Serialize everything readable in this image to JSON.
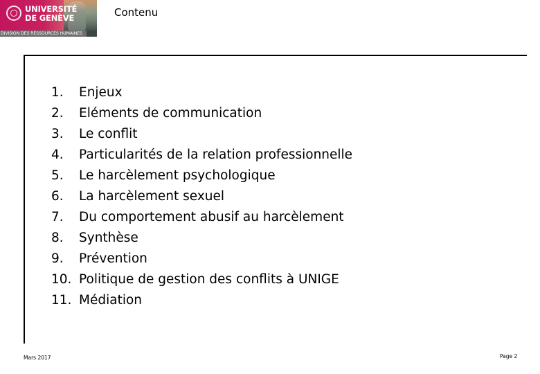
{
  "header": {
    "logo": {
      "name_line1": "UNIVERSITÉ",
      "name_line2": "DE GENÈVE",
      "division": "DIVISION DES RESSOURCES HUMAINES",
      "brand_color": "#c4145e"
    },
    "title": "Contenu"
  },
  "toc": {
    "items": [
      {
        "num": "1.",
        "label": "Enjeux"
      },
      {
        "num": "2.",
        "label": "Eléments de communication"
      },
      {
        "num": "3.",
        "label": "Le conflit"
      },
      {
        "num": "4.",
        "label": "Particularités de la relation professionnelle"
      },
      {
        "num": "5.",
        "label": "Le harcèlement psychologique"
      },
      {
        "num": "6.",
        "label": "La harcèlement sexuel"
      },
      {
        "num": "7.",
        "label": "Du comportement abusif au harcèlement"
      },
      {
        "num": "8.",
        "label": "Synthèse"
      },
      {
        "num": "9.",
        "label": "Prévention"
      },
      {
        "num": "10.",
        "label": "Politique de gestion des conflits à UNIGE"
      },
      {
        "num": "11.",
        "label": "Médiation"
      }
    ]
  },
  "footer": {
    "date": "Mars 2017",
    "page": "Page 2"
  }
}
